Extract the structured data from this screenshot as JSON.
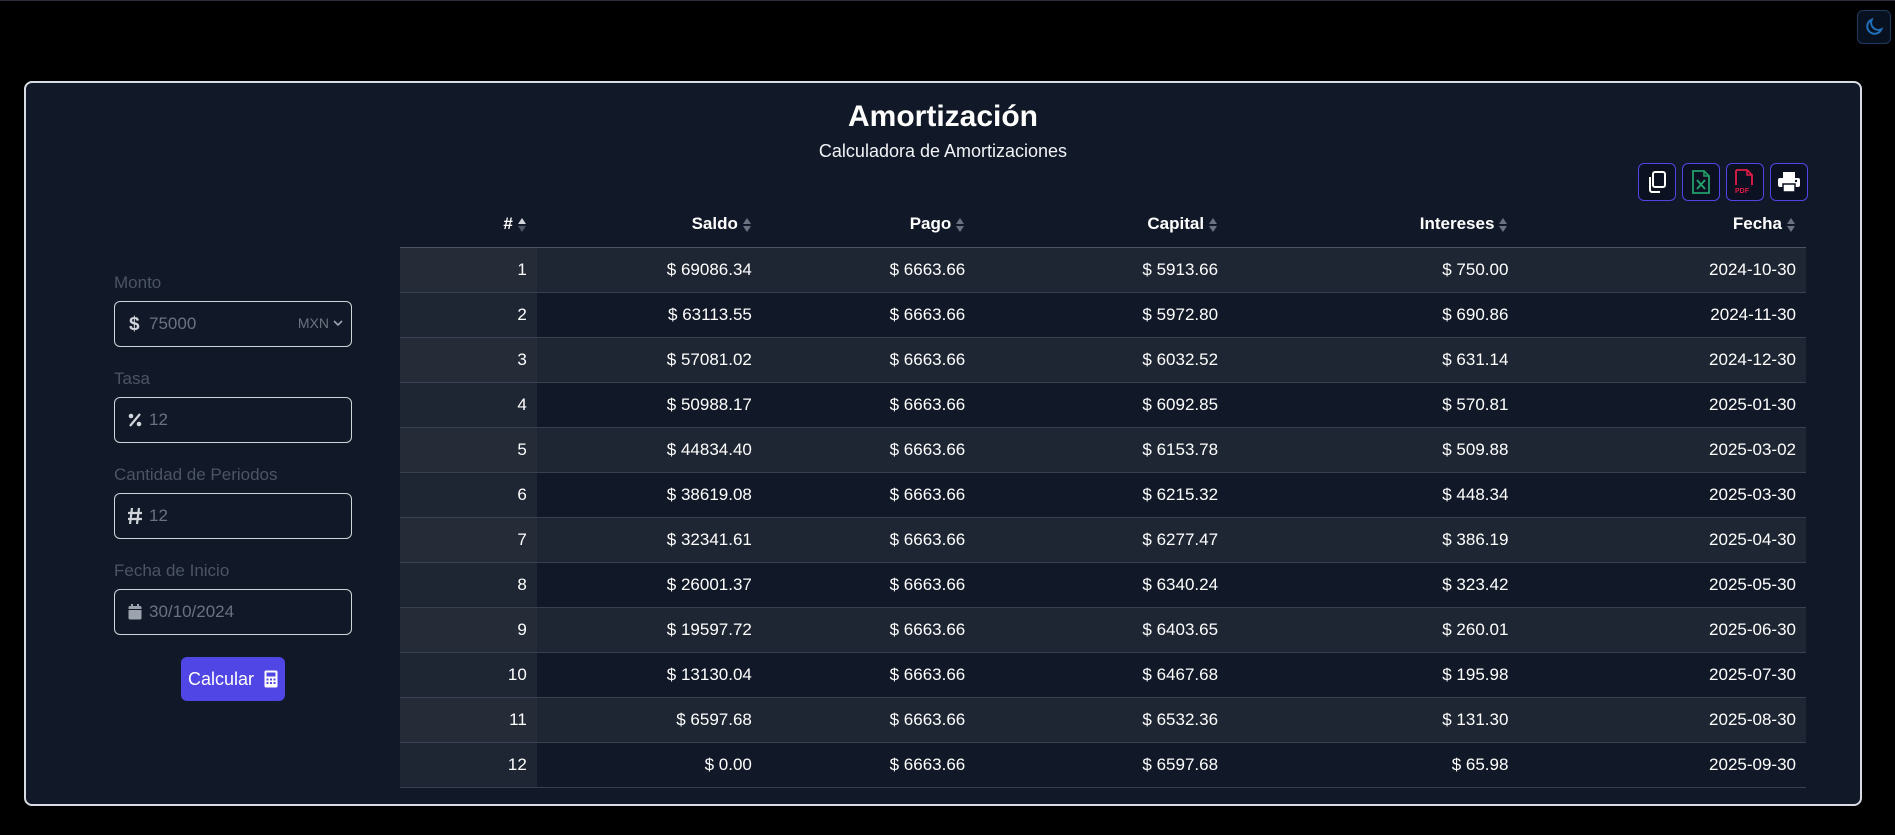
{
  "header": {
    "title": "Amortización",
    "subtitle": "Calculadora de Amortizaciones"
  },
  "theme_toggle": {
    "icon": "moon-icon"
  },
  "form": {
    "monto": {
      "label": "Monto",
      "placeholder": "75000",
      "currency": "MXN",
      "icon": "dollar-icon"
    },
    "tasa": {
      "label": "Tasa",
      "placeholder": "12",
      "icon": "percent-icon"
    },
    "periodos": {
      "label": "Cantidad de Periodos",
      "placeholder": "12",
      "icon": "hash-icon"
    },
    "fecha": {
      "label": "Fecha de Inicio",
      "value": "30/10/2024",
      "icon": "calendar-icon"
    },
    "calcular_label": "Calcular"
  },
  "toolbar": [
    "copy-icon",
    "excel-icon",
    "pdf-icon",
    "print-icon"
  ],
  "table": {
    "columns": [
      "#",
      "Saldo",
      "Pago",
      "Capital",
      "Intereses",
      "Fecha"
    ],
    "rows": [
      [
        "1",
        "$ 69086.34",
        "$ 6663.66",
        "$ 5913.66",
        "$ 750.00",
        "2024-10-30"
      ],
      [
        "2",
        "$ 63113.55",
        "$ 6663.66",
        "$ 5972.80",
        "$ 690.86",
        "2024-11-30"
      ],
      [
        "3",
        "$ 57081.02",
        "$ 6663.66",
        "$ 6032.52",
        "$ 631.14",
        "2024-12-30"
      ],
      [
        "4",
        "$ 50988.17",
        "$ 6663.66",
        "$ 6092.85",
        "$ 570.81",
        "2025-01-30"
      ],
      [
        "5",
        "$ 44834.40",
        "$ 6663.66",
        "$ 6153.78",
        "$ 509.88",
        "2025-03-02"
      ],
      [
        "6",
        "$ 38619.08",
        "$ 6663.66",
        "$ 6215.32",
        "$ 448.34",
        "2025-03-30"
      ],
      [
        "7",
        "$ 32341.61",
        "$ 6663.66",
        "$ 6277.47",
        "$ 386.19",
        "2025-04-30"
      ],
      [
        "8",
        "$ 26001.37",
        "$ 6663.66",
        "$ 6340.24",
        "$ 323.42",
        "2025-05-30"
      ],
      [
        "9",
        "$ 19597.72",
        "$ 6663.66",
        "$ 6403.65",
        "$ 260.01",
        "2025-06-30"
      ],
      [
        "10",
        "$ 13130.04",
        "$ 6663.66",
        "$ 6467.68",
        "$ 195.98",
        "2025-07-30"
      ],
      [
        "11",
        "$ 6597.68",
        "$ 6663.66",
        "$ 6532.36",
        "$ 131.30",
        "2025-08-30"
      ],
      [
        "12",
        "$ 0.00",
        "$ 6663.66",
        "$ 6597.68",
        "$ 65.98",
        "2025-09-30"
      ]
    ]
  },
  "colors": {
    "background": "#000000",
    "card": "#111827",
    "accent": "#5046e5",
    "excel": "#22a06b",
    "pdf": "#e11d48"
  }
}
